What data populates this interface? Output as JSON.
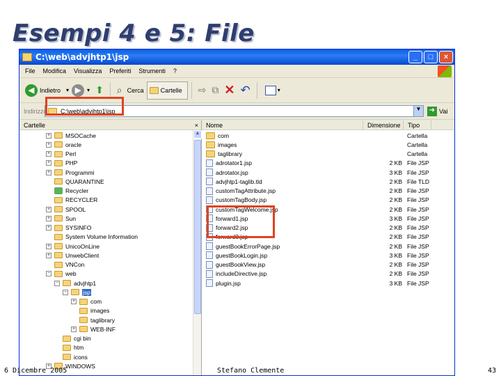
{
  "slide": {
    "title": "Esempi 4 e 5: File",
    "footer_date": "6 Dicembre 2005",
    "footer_author": "Stefano Clemente",
    "page_number": "43"
  },
  "window": {
    "title": "C:\\web\\advjhtp1\\jsp",
    "minimize": "_",
    "maximize": "□",
    "close": "×"
  },
  "menu": [
    "File",
    "Modifica",
    "Visualizza",
    "Preferiti",
    "Strumenti",
    "?"
  ],
  "toolbar": {
    "back_label": "Indietro",
    "search_label": "Cerca",
    "folders_label": "Cartelle"
  },
  "address": {
    "label": "Indirizzo",
    "value": "C:\\web\\advjhtp1\\jsp",
    "go_label": "Vai"
  },
  "left_pane": {
    "header": "Cartelle",
    "close": "×",
    "tree": [
      {
        "label": "MSOCache",
        "expander": "+",
        "icon": "folder"
      },
      {
        "label": "oracle",
        "expander": "+",
        "icon": "folder"
      },
      {
        "label": "Perl",
        "expander": "+",
        "icon": "folder"
      },
      {
        "label": "PHP",
        "expander": "+",
        "icon": "folder"
      },
      {
        "label": "Programmi",
        "expander": "+",
        "icon": "folder"
      },
      {
        "label": "QUARANTINE",
        "expander": "",
        "icon": "folder"
      },
      {
        "label": "Recycler",
        "expander": "",
        "icon": "recycle"
      },
      {
        "label": "RECYCLER",
        "expander": "",
        "icon": "folder"
      },
      {
        "label": "SPOOL",
        "expander": "+",
        "icon": "folder"
      },
      {
        "label": "Sun",
        "expander": "+",
        "icon": "folder"
      },
      {
        "label": "SYSINFO",
        "expander": "+",
        "icon": "folder"
      },
      {
        "label": "System Volume Information",
        "expander": "",
        "icon": "folder"
      },
      {
        "label": "UnicoOnLine",
        "expander": "+",
        "icon": "folder"
      },
      {
        "label": "UnwebClient",
        "expander": "+",
        "icon": "folder"
      },
      {
        "label": "VNCon",
        "expander": "",
        "icon": "folder"
      },
      {
        "label": "web",
        "expander": "-",
        "icon": "folder"
      },
      {
        "label": "advjhtp1",
        "expander": "-",
        "icon": "folder"
      },
      {
        "label": "jsp",
        "expander": "-",
        "icon": "folder"
      },
      {
        "label": "com",
        "expander": "+",
        "icon": "folder"
      },
      {
        "label": "images",
        "expander": "",
        "icon": "folder"
      },
      {
        "label": "taglibrary",
        "expander": "",
        "icon": "folder"
      },
      {
        "label": "WEB-INF",
        "expander": "+",
        "icon": "folder"
      },
      {
        "label": "cgi bin",
        "expander": "",
        "icon": "folder"
      },
      {
        "label": "htm",
        "expander": "",
        "icon": "folder"
      },
      {
        "label": "icons",
        "expander": "",
        "icon": "folder"
      },
      {
        "label": "WINDOWS",
        "expander": "+",
        "icon": "folder"
      }
    ]
  },
  "right_pane": {
    "columns": [
      "Nome",
      "Dimensione",
      "Tipo"
    ],
    "files": [
      {
        "name": "com",
        "size": "",
        "type": "Cartella",
        "icon": "folder"
      },
      {
        "name": "images",
        "size": "",
        "type": "Cartella",
        "icon": "folder"
      },
      {
        "name": "taglibrary",
        "size": "",
        "type": "Cartella",
        "icon": "folder"
      },
      {
        "name": "adrotator1.jsp",
        "size": "2 KB",
        "type": "File JSP",
        "icon": "file"
      },
      {
        "name": "adrotator.jsp",
        "size": "3 KB",
        "type": "File JSP",
        "icon": "file"
      },
      {
        "name": "advjhtp1-taglib.tld",
        "size": "2 KB",
        "type": "File TLD",
        "icon": "file"
      },
      {
        "name": "customTagAttribute.jsp",
        "size": "2 KB",
        "type": "File JSP",
        "icon": "file"
      },
      {
        "name": "customTagBody.jsp",
        "size": "2 KB",
        "type": "File JSP",
        "icon": "file"
      },
      {
        "name": "customTagWelcome.jsp",
        "size": "2 KB",
        "type": "File JSP",
        "icon": "file"
      },
      {
        "name": "forward1.jsp",
        "size": "3 KB",
        "type": "File JSP",
        "icon": "file"
      },
      {
        "name": "forward2.jsp",
        "size": "2 KB",
        "type": "File JSP",
        "icon": "file"
      },
      {
        "name": "forward3.jsp",
        "size": "2 KB",
        "type": "File JSP",
        "icon": "file"
      },
      {
        "name": "guestBookErrorPage.jsp",
        "size": "2 KB",
        "type": "File JSP",
        "icon": "file"
      },
      {
        "name": "guestBookLogin.jsp",
        "size": "3 KB",
        "type": "File JSP",
        "icon": "file"
      },
      {
        "name": "guestBookView.jsp",
        "size": "2 KB",
        "type": "File JSP",
        "icon": "file"
      },
      {
        "name": "includeDirective.jsp",
        "size": "2 KB",
        "type": "File JSP",
        "icon": "file"
      },
      {
        "name": "plugin.jsp",
        "size": "3 KB",
        "type": "File JSP",
        "icon": "file"
      }
    ]
  },
  "colors": {
    "highlight": "#e0431f",
    "titlebar": "#0a5fe4",
    "selection": "#316ac5"
  }
}
